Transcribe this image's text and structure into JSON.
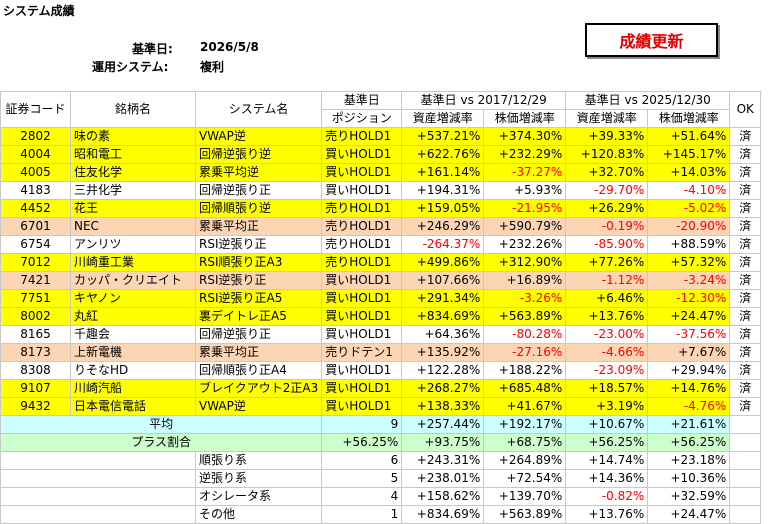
{
  "title": "システム成績",
  "base_date_label": "基準日:",
  "base_date": "2026/5/8",
  "system_label": "運用システム:",
  "system_value": "複利",
  "update_button": "成績更新",
  "headers": {
    "code": "証券コード",
    "name": "銘柄名",
    "system": "システム名",
    "base_top": "基準日",
    "position": "ポジション",
    "period1": "基準日 vs 2017/12/29",
    "period2": "基準日 vs 2025/12/30",
    "asset": "資産増減率",
    "price": "株価増減率",
    "ok": "OK"
  },
  "rows": [
    {
      "code": "2802",
      "name": "味の素",
      "system": "VWAP逆",
      "pos": "売りHOLD1",
      "a1": "+537.21%",
      "p1": "+374.30%",
      "a2": "+39.33%",
      "p2": "+51.64%",
      "ok": "済",
      "color": "yel",
      "a1r": false,
      "p1r": false,
      "a2r": false,
      "p2r": false
    },
    {
      "code": "4004",
      "name": "昭和電工",
      "system": "回帰逆張り逆",
      "pos": "買いHOLD1",
      "a1": "+622.76%",
      "p1": "+232.29%",
      "a2": "+120.83%",
      "p2": "+145.17%",
      "ok": "済",
      "color": "yel",
      "a1r": false,
      "p1r": false,
      "a2r": false,
      "p2r": false
    },
    {
      "code": "4005",
      "name": "住友化学",
      "system": "累乗平均逆",
      "pos": "買いHOLD1",
      "a1": "+161.14%",
      "p1": "-37.27%",
      "a2": "+32.70%",
      "p2": "+14.03%",
      "ok": "済",
      "color": "yel",
      "a1r": false,
      "p1r": true,
      "a2r": false,
      "p2r": false
    },
    {
      "code": "4183",
      "name": "三井化学",
      "system": "回帰逆張り正",
      "pos": "買いHOLD1",
      "a1": "+194.31%",
      "p1": "+5.93%",
      "a2": "-29.70%",
      "p2": "-4.10%",
      "ok": "済",
      "color": "wht",
      "a1r": false,
      "p1r": false,
      "a2r": true,
      "p2r": true
    },
    {
      "code": "4452",
      "name": "花王",
      "system": "回帰順張り逆",
      "pos": "売りHOLD1",
      "a1": "+159.05%",
      "p1": "-21.95%",
      "a2": "+26.29%",
      "p2": "-5.02%",
      "ok": "済",
      "color": "yel",
      "a1r": false,
      "p1r": true,
      "a2r": false,
      "p2r": true
    },
    {
      "code": "6701",
      "name": "NEC",
      "system": "累乗平均正",
      "pos": "売りHOLD1",
      "a1": "+246.29%",
      "p1": "+590.79%",
      "a2": "-0.19%",
      "p2": "-20.90%",
      "ok": "済",
      "color": "pch",
      "a1r": false,
      "p1r": false,
      "a2r": true,
      "p2r": true
    },
    {
      "code": "6754",
      "name": "アンリツ",
      "system": "RSI逆張り正",
      "pos": "売りHOLD1",
      "a1": "-264.37%",
      "p1": "+232.26%",
      "a2": "-85.90%",
      "p2": "+88.59%",
      "ok": "済",
      "color": "wht",
      "a1r": true,
      "p1r": false,
      "a2r": true,
      "p2r": false
    },
    {
      "code": "7012",
      "name": "川崎重工業",
      "system": "RSI順張り正A3",
      "pos": "売りHOLD1",
      "a1": "+499.86%",
      "p1": "+312.90%",
      "a2": "+77.26%",
      "p2": "+57.32%",
      "ok": "済",
      "color": "yel",
      "a1r": false,
      "p1r": false,
      "a2r": false,
      "p2r": false
    },
    {
      "code": "7421",
      "name": "カッパ・クリエイト",
      "system": "RSI逆張り正",
      "pos": "買いHOLD1",
      "a1": "+107.66%",
      "p1": "+16.89%",
      "a2": "-1.12%",
      "p2": "-3.24%",
      "ok": "済",
      "color": "pch",
      "a1r": false,
      "p1r": false,
      "a2r": true,
      "p2r": true
    },
    {
      "code": "7751",
      "name": "キヤノン",
      "system": "RSI逆張り正A5",
      "pos": "買いHOLD1",
      "a1": "+291.34%",
      "p1": "-3.26%",
      "a2": "+6.46%",
      "p2": "-12.30%",
      "ok": "済",
      "color": "yel",
      "a1r": false,
      "p1r": true,
      "a2r": false,
      "p2r": true
    },
    {
      "code": "8002",
      "name": "丸紅",
      "system": "裏デイトレ正A5",
      "pos": "買いHOLD1",
      "a1": "+834.69%",
      "p1": "+563.89%",
      "a2": "+13.76%",
      "p2": "+24.47%",
      "ok": "済",
      "color": "yel",
      "a1r": false,
      "p1r": false,
      "a2r": false,
      "p2r": false
    },
    {
      "code": "8165",
      "name": "千趣会",
      "system": "回帰逆張り正",
      "pos": "買いHOLD1",
      "a1": "+64.36%",
      "p1": "-80.28%",
      "a2": "-23.00%",
      "p2": "-37.56%",
      "ok": "済",
      "color": "wht",
      "a1r": false,
      "p1r": true,
      "a2r": true,
      "p2r": true
    },
    {
      "code": "8173",
      "name": "上新電機",
      "system": "累乗平均正",
      "pos": "売りドテン1",
      "a1": "+135.92%",
      "p1": "-27.16%",
      "a2": "-4.66%",
      "p2": "+7.67%",
      "ok": "済",
      "color": "pch",
      "a1r": false,
      "p1r": true,
      "a2r": true,
      "p2r": false
    },
    {
      "code": "8308",
      "name": "りそなHD",
      "system": "回帰順張り正A4",
      "pos": "買いHOLD1",
      "a1": "+122.28%",
      "p1": "+188.22%",
      "a2": "-23.09%",
      "p2": "+29.94%",
      "ok": "済",
      "color": "wht",
      "a1r": false,
      "p1r": false,
      "a2r": true,
      "p2r": false
    },
    {
      "code": "9107",
      "name": "川崎汽船",
      "system": "ブレイクアウト2正A3",
      "pos": "買いHOLD1",
      "a1": "+268.27%",
      "p1": "+685.48%",
      "a2": "+18.57%",
      "p2": "+14.76%",
      "ok": "済",
      "color": "yel",
      "a1r": false,
      "p1r": false,
      "a2r": false,
      "p2r": false
    },
    {
      "code": "9432",
      "name": "日本電信電話",
      "system": "VWAP逆",
      "pos": "買いHOLD1",
      "a1": "+138.33%",
      "p1": "+41.67%",
      "a2": "+3.19%",
      "p2": "-4.76%",
      "ok": "済",
      "color": "yel",
      "a1r": false,
      "p1r": false,
      "a2r": false,
      "p2r": true
    }
  ],
  "avg": {
    "label": "平均",
    "count": "9",
    "a1": "+257.44%",
    "p1": "+192.17%",
    "a2": "+10.67%",
    "p2": "+21.61%"
  },
  "plus": {
    "label": "プラス割合",
    "pct": "+56.25%",
    "a1": "+93.75%",
    "p1": "+68.75%",
    "a2": "+56.25%",
    "p2": "+56.25%"
  },
  "groups": [
    {
      "label": "順張り系",
      "count": "6",
      "a1": "+243.31%",
      "p1": "+264.89%",
      "a2": "+14.74%",
      "p2": "+23.18%",
      "a2r": false
    },
    {
      "label": "逆張り系",
      "count": "5",
      "a1": "+238.01%",
      "p1": "+72.54%",
      "a2": "+14.36%",
      "p2": "+10.36%",
      "a2r": false
    },
    {
      "label": "オシレータ系",
      "count": "4",
      "a1": "+158.62%",
      "p1": "+139.70%",
      "a2": "-0.82%",
      "p2": "+32.59%",
      "a2r": true
    },
    {
      "label": "その他",
      "count": "1",
      "a1": "+834.69%",
      "p1": "+563.89%",
      "a2": "+13.76%",
      "p2": "+24.47%",
      "a2r": false
    }
  ]
}
